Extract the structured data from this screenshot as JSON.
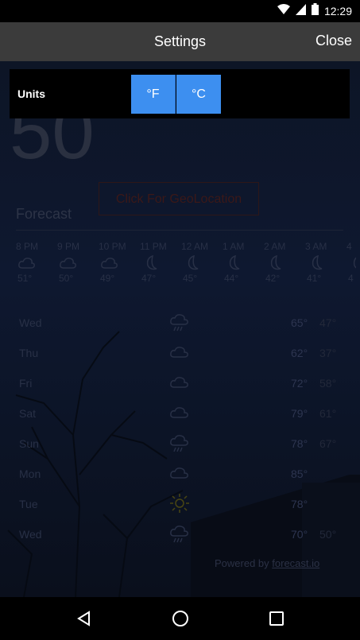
{
  "status_bar": {
    "time": "12:29",
    "icons": [
      "wifi-icon",
      "signal-icon",
      "battery-icon"
    ]
  },
  "header": {
    "title": "Settings",
    "close_label": "Close"
  },
  "settings": {
    "units_label": "Units",
    "options": [
      "°F",
      "°C"
    ]
  },
  "background": {
    "current_temp": "50",
    "geolocation_button": "Click For GeoLocation",
    "forecast_title": "Forecast",
    "hourly": [
      {
        "time": "8 PM",
        "icon": "cloud-icon",
        "temp": "51°"
      },
      {
        "time": "9 PM",
        "icon": "cloud-icon",
        "temp": "50°"
      },
      {
        "time": "10 PM",
        "icon": "cloud-icon",
        "temp": "49°"
      },
      {
        "time": "11 PM",
        "icon": "moon-icon",
        "temp": "47°"
      },
      {
        "time": "12 AM",
        "icon": "moon-icon",
        "temp": "45°"
      },
      {
        "time": "1 AM",
        "icon": "moon-icon",
        "temp": "44°"
      },
      {
        "time": "2 AM",
        "icon": "moon-icon",
        "temp": "42°"
      },
      {
        "time": "3 AM",
        "icon": "moon-icon",
        "temp": "41°"
      },
      {
        "time": "4",
        "icon": "moon-icon",
        "temp": "4"
      }
    ],
    "daily": [
      {
        "day": "Wed",
        "icon": "rain-icon",
        "high": "65°",
        "low": "47°"
      },
      {
        "day": "Thu",
        "icon": "cloud-icon",
        "high": "62°",
        "low": "37°"
      },
      {
        "day": "Fri",
        "icon": "cloud-icon",
        "high": "72°",
        "low": "58°"
      },
      {
        "day": "Sat",
        "icon": "cloud-icon",
        "high": "79°",
        "low": "61°"
      },
      {
        "day": "Sun",
        "icon": "rain-icon",
        "high": "78°",
        "low": "67°"
      },
      {
        "day": "Mon",
        "icon": "cloud-icon",
        "high": "85°",
        "low": ""
      },
      {
        "day": "Tue",
        "icon": "sun-icon",
        "high": "78°",
        "low": ""
      },
      {
        "day": "Wed",
        "icon": "rain-icon",
        "high": "70°",
        "low": "50°"
      }
    ],
    "powered_prefix": "Powered by",
    "powered_link": "forecast.io"
  },
  "navbar": {
    "icons": [
      "back-icon",
      "home-icon",
      "recents-icon"
    ]
  },
  "colors": {
    "accent": "#3d8ff0",
    "header_bg": "#3b3b3b"
  }
}
